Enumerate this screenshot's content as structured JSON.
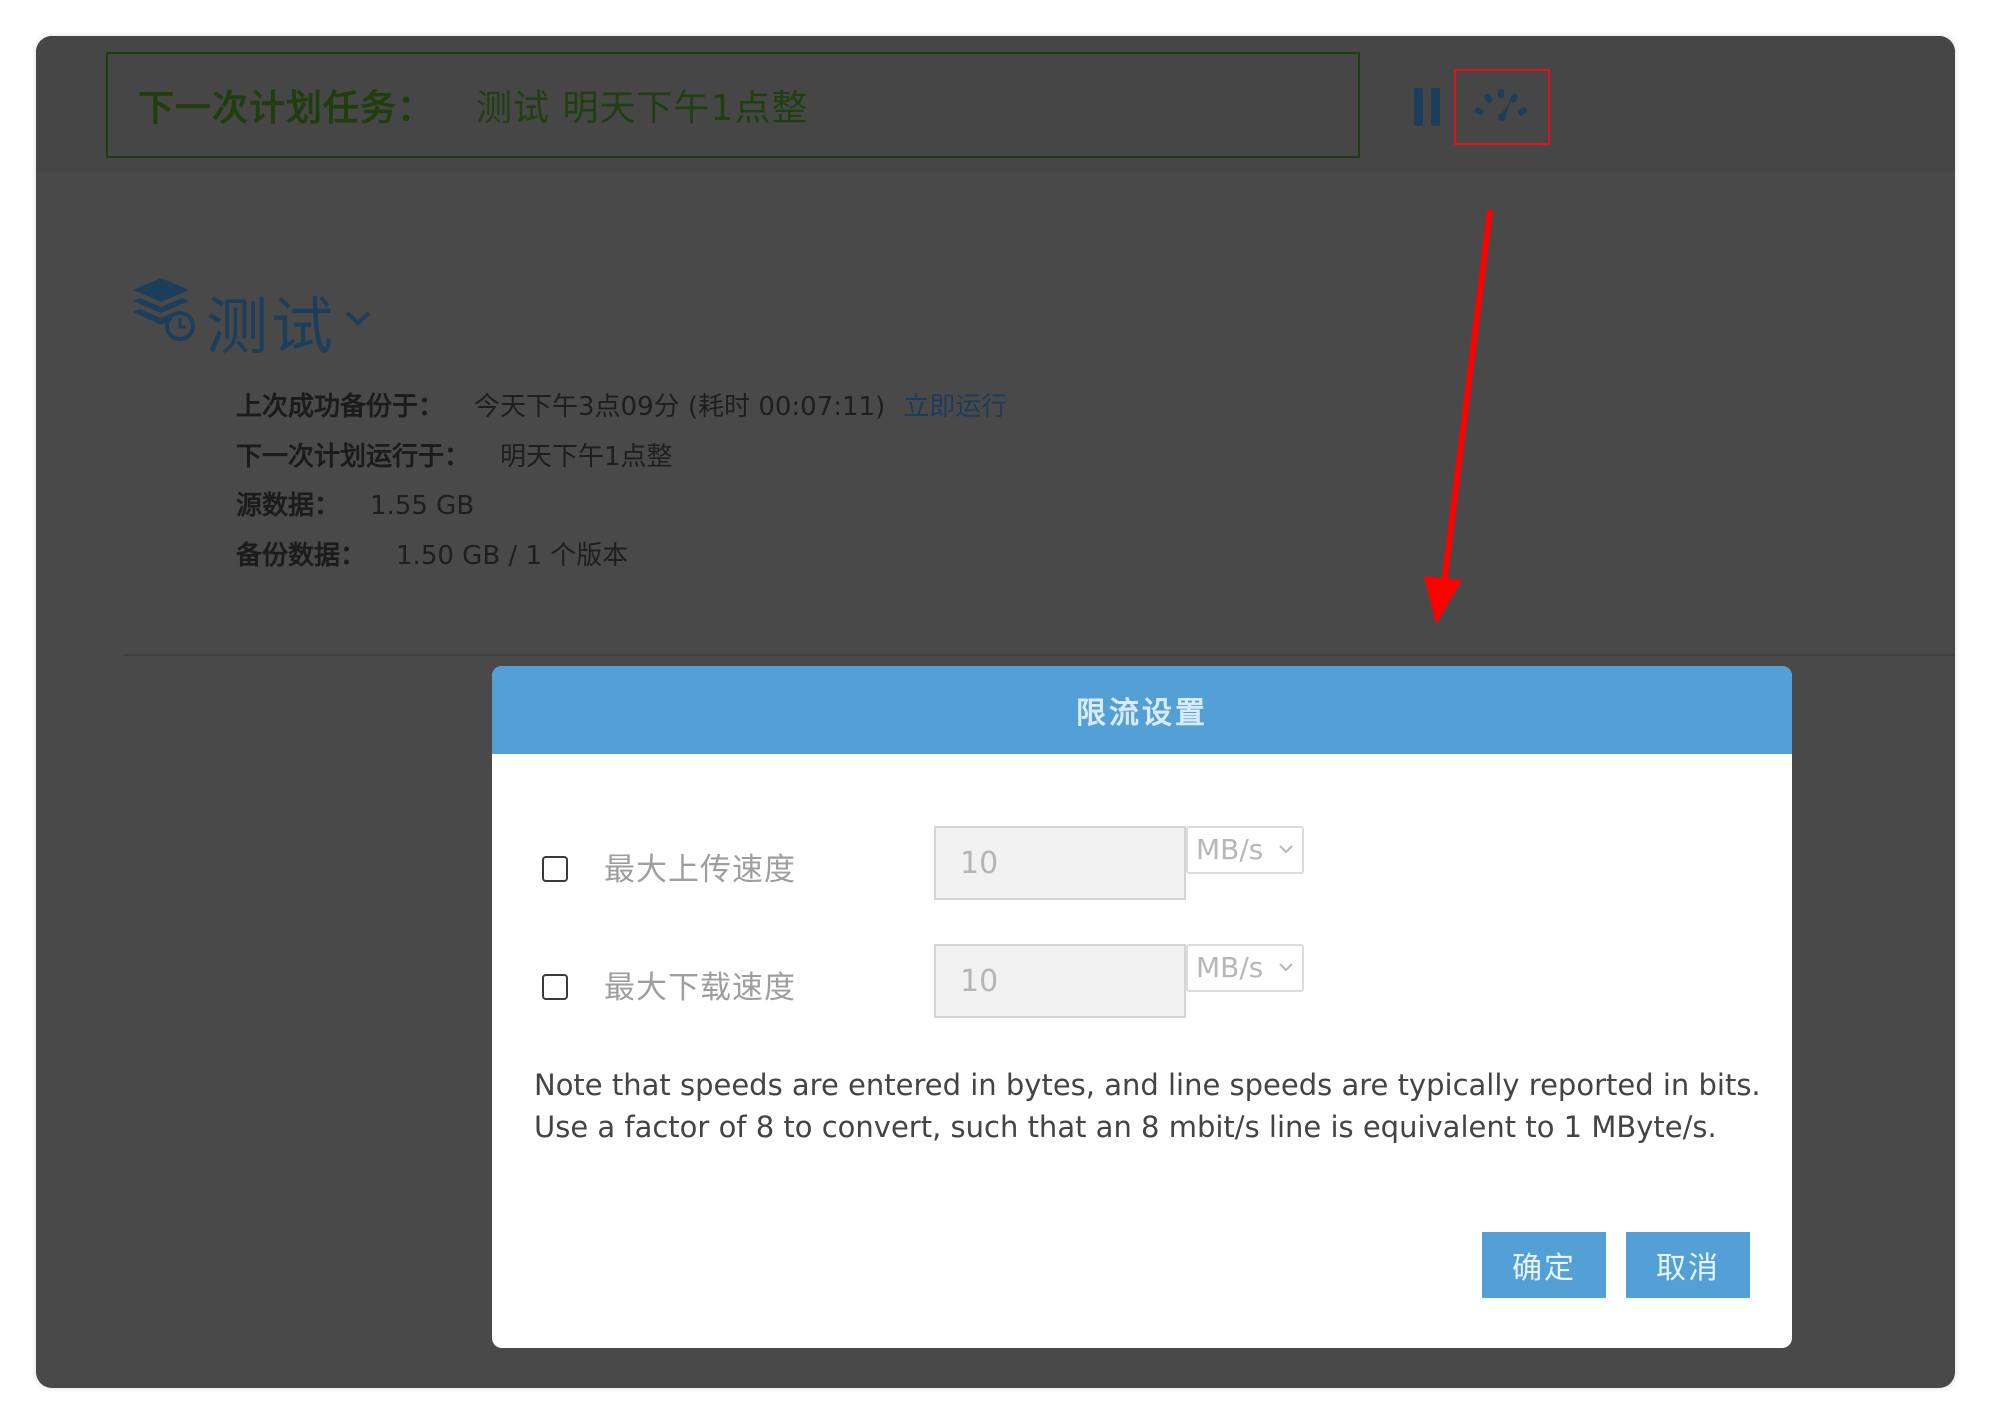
{
  "top_bar": {
    "next_task_label": "下一次计划任务：",
    "next_task_value": "测试 明天下午1点整",
    "pause_icon": "pause-icon",
    "throttle_icon": "speedometer-icon"
  },
  "plan": {
    "title": "测试",
    "icon": "backup-database-icon",
    "last_success_label": "上次成功备份于：",
    "last_success_value": "今天下午3点09分 (耗时 00:07:11)",
    "run_now_link": "立即运行",
    "next_run_label": "下一次计划运行于：",
    "next_run_value": "明天下午1点整",
    "source_label": "源数据：",
    "source_value": "1.55 GB",
    "backup_label": "备份数据：",
    "backup_value": "1.50 GB / 1 个版本"
  },
  "dialog": {
    "title": "限流设置",
    "upload": {
      "label": "最大上传速度",
      "checked": false,
      "value": "10",
      "unit": "MB/s"
    },
    "download": {
      "label": "最大下载速度",
      "checked": false,
      "value": "10",
      "unit": "MB/s"
    },
    "note_line1": "Note that speeds are entered in bytes, and line speeds are typically reported in bits.",
    "note_line2": "Use a factor of 8 to convert, such that an 8 mbit/s line is equivalent to 1 MByte/s.",
    "ok_label": "确定",
    "cancel_label": "取消"
  },
  "colors": {
    "overlay_bg": "#494949",
    "accent": "#52a0d5",
    "annotation": "#e0121c",
    "dark_blue": "#1d3e5a"
  }
}
